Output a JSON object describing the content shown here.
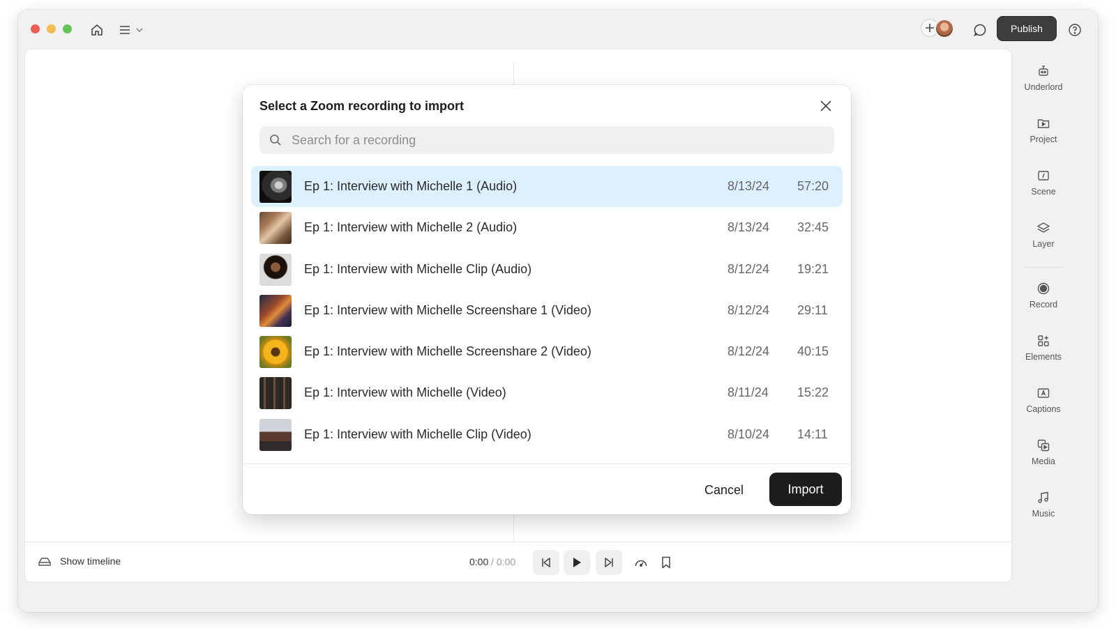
{
  "window": {
    "publish_label": "Publish"
  },
  "modal": {
    "title": "Select a Zoom recording to import",
    "search_placeholder": "Search for a recording",
    "search_value": "",
    "recordings": [
      {
        "title": "Ep 1: Interview with Michelle 1 (Audio)",
        "date": "8/13/24",
        "duration": "57:20",
        "selected": true
      },
      {
        "title": "Ep 1: Interview with Michelle 2 (Audio)",
        "date": "8/13/24",
        "duration": "32:45",
        "selected": false
      },
      {
        "title": "Ep 1: Interview with Michelle Clip (Audio)",
        "date": "8/12/24",
        "duration": "19:21",
        "selected": false
      },
      {
        "title": "Ep 1: Interview with Michelle Screenshare 1 (Video)",
        "date": "8/12/24",
        "duration": "29:11",
        "selected": false
      },
      {
        "title": "Ep 1: Interview with Michelle Screenshare 2 (Video)",
        "date": "8/12/24",
        "duration": "40:15",
        "selected": false
      },
      {
        "title": "Ep 1: Interview with Michelle (Video)",
        "date": "8/11/24",
        "duration": "15:22",
        "selected": false
      },
      {
        "title": "Ep 1: Interview with Michelle Clip (Video)",
        "date": "8/10/24",
        "duration": "14:11",
        "selected": false
      }
    ],
    "cancel_label": "Cancel",
    "import_label": "Import"
  },
  "sidebar": {
    "items": [
      {
        "label": "Underlord",
        "icon": "robot-icon"
      },
      {
        "label": "Project",
        "icon": "project-icon"
      },
      {
        "label": "Scene",
        "icon": "scene-icon"
      },
      {
        "label": "Layer",
        "icon": "layer-icon"
      },
      {
        "label": "Record",
        "icon": "record-icon"
      },
      {
        "label": "Elements",
        "icon": "elements-icon"
      },
      {
        "label": "Captions",
        "icon": "captions-icon"
      },
      {
        "label": "Media",
        "icon": "media-icon"
      },
      {
        "label": "Music",
        "icon": "music-icon"
      }
    ]
  },
  "playback": {
    "show_timeline_label": "Show timeline",
    "current_time": "0:00",
    "separator": " / ",
    "total_time": "0:00"
  },
  "colors": {
    "selected_row": "#dcf0fd",
    "primary_button": "#1d1d1d",
    "publish_button": "#3d3d3d"
  }
}
